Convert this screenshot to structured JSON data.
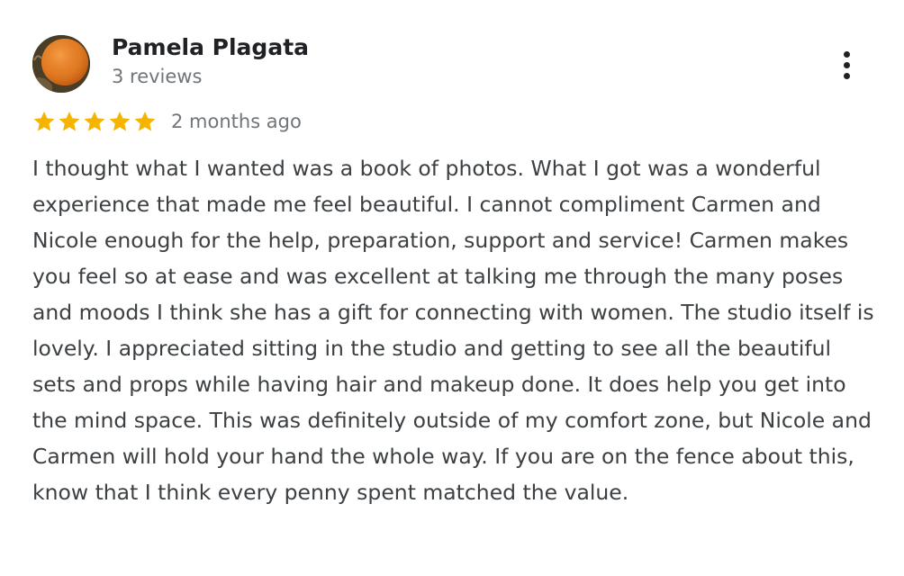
{
  "reviewer": {
    "name": "Pamela Plagata",
    "review_count": "3 reviews",
    "avatar_icon": "orange-fruit-avatar"
  },
  "rating": {
    "stars": 5,
    "max_stars": 5,
    "star_color": "#f4b400",
    "date": "2 months ago"
  },
  "review": {
    "text": "I thought what I wanted was a book of photos. What I got was a wonderful experience that made me feel beautiful. I cannot compliment Carmen and Nicole enough for the help, preparation, support and service! Carmen makes you feel so at ease and was excellent at talking me through the many poses and moods I think she has a gift for connecting with women. The studio itself is lovely. I appreciated sitting in the studio and getting to see all the beautiful sets and props while having hair and makeup done. It does help you get into the mind space. This was definitely outside of my comfort zone, but Nicole and Carmen will hold your hand the whole way. If you are on the fence about this, know that I think every penny spent matched the value."
  },
  "actions": {
    "more_icon": "more-vert-icon"
  }
}
